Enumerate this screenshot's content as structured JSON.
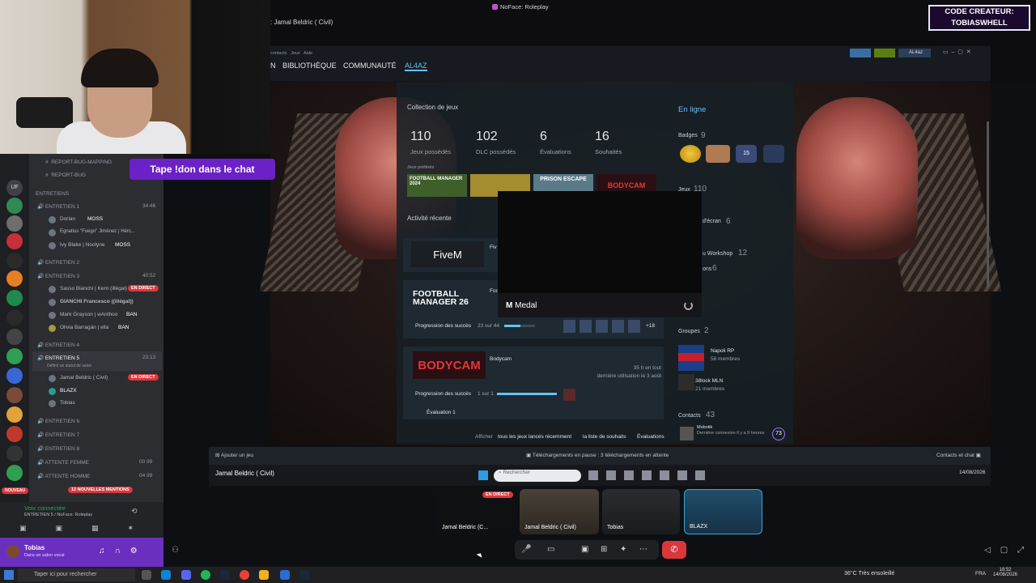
{
  "window_title": "NoFace: Roleplay",
  "stream_owner": "Jamal Beldric ( Civil)",
  "creator_code": {
    "line1": "CODE CREATEUR:",
    "line2": "TOBIASWHELL"
  },
  "discord": {
    "chat_banner": "Tape !don dans le chat",
    "top_channels": [
      "REPORT-BUG-MAPPING",
      "REPORT-BUG"
    ],
    "category": "ENTRETIENS",
    "channels": [
      {
        "name": "ENTRETIEN 1",
        "time": "34:46",
        "users": [
          "Dorian",
          "Egnatius \"Fuego\" Jiménez | Hérc...",
          "Ivy Blake | Noolyne"
        ]
      },
      {
        "name": "ENTRETIEN 2"
      },
      {
        "name": "ENTRETIEN 3",
        "time": "40:52",
        "users": [
          "Sasso Bianchi | Kern (illégal)",
          "GIANCHI Francesco ((illégal))",
          "Mark Grayson | wAnthoo",
          "Olivia Barragán | ella"
        ]
      },
      {
        "name": "ENTRETIEN 4"
      },
      {
        "name": "ENTRETIEN 5",
        "time": "23:13",
        "status": "Définir un statut de salon",
        "users": [
          "Jamal Beldric ( Civil)",
          "BLAZX",
          "Tobias"
        ]
      },
      {
        "name": "ENTRETIEN 6"
      },
      {
        "name": "ENTRETIEN 7"
      },
      {
        "name": "ENTRETIEN 8"
      },
      {
        "name": "ATTENTE FEMME",
        "count": "00 99"
      },
      {
        "name": "ATTENTE HOMME",
        "count": "04 99"
      }
    ],
    "tags": {
      "moss": "MOSS",
      "ban": "BAN",
      "live": "EN DIRECT"
    },
    "mentions": "12 NOUVELLES MENTIONS",
    "new_label": "NOUVEAU",
    "voice": {
      "title": "Voix connectée",
      "channel": "ENTRETIEN 5 / NoFace: Roleplay"
    },
    "user": {
      "name": "Tobias",
      "status": "Dans un salon vocal"
    }
  },
  "steam": {
    "nav": [
      "N",
      "BIBLIOTHÈQUE",
      "COMMUNAUTÉ",
      "AL4AZ"
    ],
    "small_nav": [
      "contacts",
      "Jeux",
      "Aide"
    ],
    "account": "AL4az",
    "collection_title": "Collection de jeux",
    "stats": [
      {
        "value": "110",
        "label": "Jeux possédés"
      },
      {
        "value": "102",
        "label": "DLC possédés"
      },
      {
        "value": "6",
        "label": "Évaluations"
      },
      {
        "value": "16",
        "label": "Souhaités"
      }
    ],
    "favorites_label": "Jeux préférés",
    "favorite_games": [
      "FOOTBALL MANAGER 2024",
      "",
      "PRISON ESCAPE",
      "BODYCAM"
    ],
    "activity_title": "Activité récente",
    "games": [
      {
        "logo": "FiveM",
        "name": "Fiv"
      },
      {
        "logo": "FOOTBALL MANAGER 26",
        "name": "Foo",
        "progress_label": "Progression des succès",
        "progress": "23 sur 44",
        "more": "+18"
      },
      {
        "logo": "BODYCAM",
        "name": "Bodycam",
        "hours": "35 h en tout",
        "last": "dernière utilisation le 3 août",
        "progress_label": "Progression des succès",
        "progress": "1 sur 1",
        "review": "Évaluation 1"
      }
    ],
    "footer": {
      "prefix": "Afficher",
      "links": [
        "tous les jeux lancés récemment",
        "la liste de souhaits",
        "Évaluations"
      ]
    },
    "online": "En ligne",
    "badges": {
      "label": "Badges",
      "count": "9"
    },
    "games_count": {
      "label": "Jeux",
      "count": "110"
    },
    "screenshots": {
      "label": "d'écran",
      "count": "6"
    },
    "workshop": {
      "label": "u Workshop",
      "count": "12"
    },
    "reviews": {
      "label": "ons",
      "count": "6"
    },
    "groups": {
      "label": "Groupes",
      "count": "2",
      "items": [
        {
          "name": "Napoli RP",
          "members": "58 membres"
        },
        {
          "name": "38lock MLN",
          "members": "21 membres"
        }
      ]
    },
    "contacts": {
      "label": "Contacts",
      "count": "43",
      "first": "Mobotik",
      "first_status": "Dernière connexion il y a 9 heures",
      "level": "73"
    },
    "bottom_bar": {
      "add_game": "Ajouter un jeu",
      "downloads": "Téléchargements en pause : 3 téléchargements en attente",
      "chat": "Contacts et chat"
    }
  },
  "medal": {
    "label": "Medal"
  },
  "inner_taskbar": {
    "search": "Rechercher",
    "time": "18:52",
    "date": "14/08/2026"
  },
  "participants": [
    {
      "name": "Jamal Beldric (C...",
      "live": "EN DIRECT"
    },
    {
      "name": "Jamal Beldric ( Civil)"
    },
    {
      "name": "Tobias"
    },
    {
      "name": "BLAZX"
    }
  ],
  "os_taskbar": {
    "search": "Taper ici pour rechercher",
    "weather": "36°C  Très ensoleillé",
    "lang": "FRA",
    "time": "18:52",
    "date": "14/08/2026"
  },
  "colors": {
    "discord_purple": "#6b21c7",
    "live_red": "#da373c",
    "steam_blue": "#66c0f4"
  }
}
